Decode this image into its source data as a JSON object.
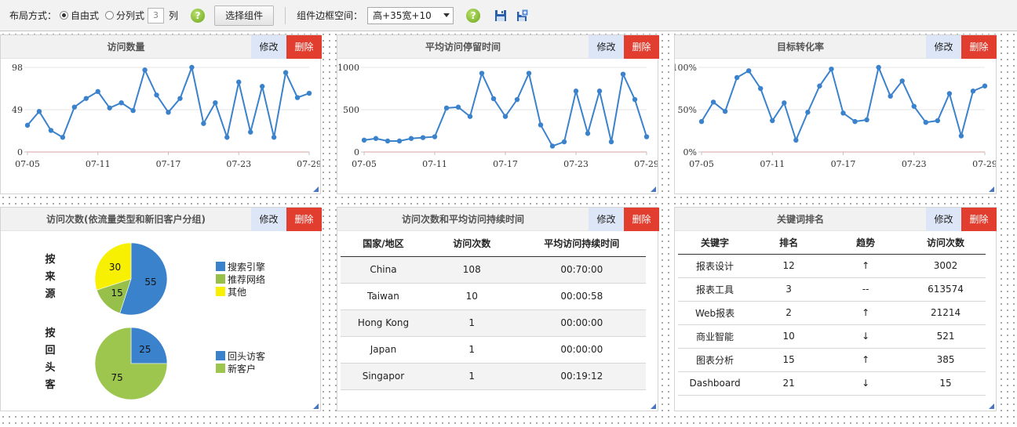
{
  "toolbar": {
    "layout_label": "布局方式：",
    "free_label": "自由式",
    "column_label": "分列式",
    "column_value": "3",
    "column_unit": "列",
    "help_glyph": "?",
    "select_button": "选择组件",
    "border_label": "组件边框空间：",
    "border_value": "高+35宽+10",
    "colors": {
      "help": "#7cb52a",
      "accent": "#3366aa"
    }
  },
  "common": {
    "edit": "修改",
    "delete": "删除"
  },
  "panels": {
    "p1": {
      "title": "访问数量"
    },
    "p2": {
      "title": "平均访问停留时间"
    },
    "p3": {
      "title": "目标转化率"
    },
    "p4": {
      "title": "访问次数(依流量类型和新旧客户分组)"
    },
    "p5": {
      "title": "访问次数和平均访问持续时间"
    },
    "p6": {
      "title": "关键词排名"
    }
  },
  "chart_data": [
    {
      "type": "line",
      "title": "访问数量",
      "x": [
        "07-05",
        "07-06",
        "07-07",
        "07-08",
        "07-09",
        "07-10",
        "07-11",
        "07-12",
        "07-13",
        "07-14",
        "07-15",
        "07-16",
        "07-17",
        "07-18",
        "07-19",
        "07-20",
        "07-21",
        "07-22",
        "07-23",
        "07-24",
        "07-25",
        "07-26",
        "07-27",
        "07-28",
        "07-29"
      ],
      "xticks": [
        "07-05",
        "07-11",
        "07-17",
        "07-23",
        "07-29"
      ],
      "yticks": [
        "0",
        "49",
        "98"
      ],
      "ylim": [
        0,
        98
      ],
      "values": [
        31,
        47,
        25,
        17,
        52,
        62,
        70,
        51,
        57,
        48,
        95,
        66,
        46,
        62,
        98,
        33,
        57,
        17,
        81,
        23,
        76,
        17,
        92,
        63,
        68
      ],
      "color": "#3b82cc"
    },
    {
      "type": "line",
      "title": "平均访问停留时间",
      "x": [
        "07-05",
        "07-06",
        "07-07",
        "07-08",
        "07-09",
        "07-10",
        "07-11",
        "07-12",
        "07-13",
        "07-14",
        "07-15",
        "07-16",
        "07-17",
        "07-18",
        "07-19",
        "07-20",
        "07-21",
        "07-22",
        "07-23",
        "07-24",
        "07-25",
        "07-26",
        "07-27",
        "07-28",
        "07-29"
      ],
      "xticks": [
        "07-05",
        "07-11",
        "07-17",
        "07-23",
        "07-29"
      ],
      "yticks": [
        "0",
        "500",
        "1000"
      ],
      "ylim": [
        0,
        1000
      ],
      "values": [
        140,
        160,
        130,
        130,
        160,
        170,
        180,
        520,
        530,
        420,
        930,
        630,
        420,
        620,
        930,
        320,
        70,
        120,
        720,
        220,
        720,
        120,
        920,
        620,
        180
      ],
      "color": "#3b82cc"
    },
    {
      "type": "line",
      "title": "目标转化率",
      "x": [
        "07-05",
        "07-06",
        "07-07",
        "07-08",
        "07-09",
        "07-10",
        "07-11",
        "07-12",
        "07-13",
        "07-14",
        "07-15",
        "07-16",
        "07-17",
        "07-18",
        "07-19",
        "07-20",
        "07-21",
        "07-22",
        "07-23",
        "07-24",
        "07-25",
        "07-26",
        "07-27",
        "07-28",
        "07-29"
      ],
      "xticks": [
        "07-05",
        "07-11",
        "07-17",
        "07-23",
        "07-29"
      ],
      "yticks": [
        "0%",
        "50%",
        "100%"
      ],
      "ylim": [
        0,
        100
      ],
      "values": [
        36,
        59,
        48,
        88,
        96,
        75,
        37,
        58,
        14,
        47,
        78,
        98,
        46,
        36,
        38,
        100,
        66,
        84,
        54,
        35,
        37,
        69,
        19,
        72,
        78
      ],
      "color": "#3b82cc"
    },
    {
      "type": "pie",
      "title": "按来源",
      "labels": [
        "搜索引擎",
        "推荐网络",
        "其他"
      ],
      "values": [
        55,
        15,
        30
      ],
      "colors": [
        "#3b82cc",
        "#97c04a",
        "#f8f003"
      ]
    },
    {
      "type": "pie",
      "title": "按回头客",
      "labels": [
        "回头访客",
        "新客户"
      ],
      "values": [
        25,
        75
      ],
      "colors": [
        "#3b82cc",
        "#9cc64e"
      ]
    }
  ],
  "pie_labels": {
    "source": "按来源",
    "returning": "按回头客"
  },
  "visits_table": {
    "headers": [
      "国家/地区",
      "访问次数",
      "平均访问持续时间"
    ],
    "rows": [
      [
        "China",
        "108",
        "00:70:00"
      ],
      [
        "Taiwan",
        "10",
        "00:00:58"
      ],
      [
        "Hong Kong",
        "1",
        "00:00:00"
      ],
      [
        "Japan",
        "1",
        "00:00:00"
      ],
      [
        "Singapor",
        "1",
        "00:19:12"
      ]
    ]
  },
  "keyword_table": {
    "headers": [
      "关键字",
      "排名",
      "趋势",
      "访问次数"
    ],
    "rows": [
      [
        "报表设计",
        "12",
        "↑",
        "3002"
      ],
      [
        "报表工具",
        "3",
        "--",
        "613574"
      ],
      [
        "Web报表",
        "2",
        "↑",
        "21214"
      ],
      [
        "商业智能",
        "10",
        "↓",
        "521"
      ],
      [
        "图表分析",
        "15",
        "↑",
        "385"
      ],
      [
        "Dashboard",
        "21",
        "↓",
        "15"
      ]
    ]
  }
}
